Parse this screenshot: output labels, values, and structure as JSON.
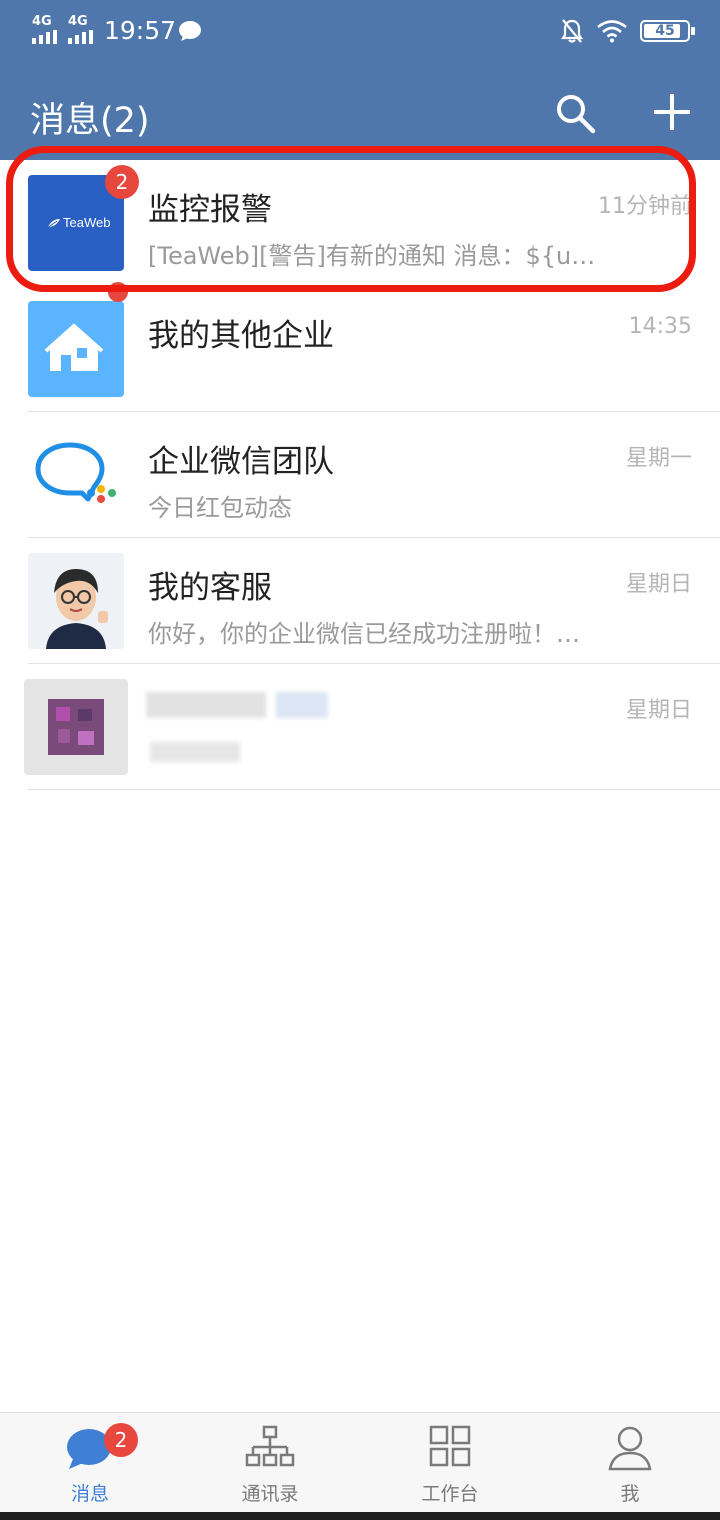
{
  "status_bar": {
    "network1": "4G",
    "network2": "4G",
    "time": "19:57",
    "battery": "45"
  },
  "header": {
    "title": "消息(2)"
  },
  "conversations": [
    {
      "name": "监控报警",
      "preview": "[TeaWeb][警告]有新的通知 消息：${u…",
      "time": "11分钟前",
      "badge": "2",
      "avatar_text": "TeaWeb",
      "avatar_bg": "#2a5fc4"
    },
    {
      "name": "我的其他企业",
      "preview": "",
      "time": "14:35",
      "avatar_bg": "#5ab4ff"
    },
    {
      "name": "企业微信团队",
      "preview": "今日红包动态",
      "time": "星期一"
    },
    {
      "name": "我的客服",
      "preview": "你好，你的企业微信已经成功注册啦！…",
      "time": "星期日"
    },
    {
      "name": "",
      "preview": "",
      "time": "星期日"
    }
  ],
  "tabbar": {
    "tabs": [
      {
        "label": "消息",
        "badge": "2",
        "active": true
      },
      {
        "label": "通讯录"
      },
      {
        "label": "工作台"
      },
      {
        "label": "我"
      }
    ]
  },
  "colors": {
    "header_bg": "#4f77ab",
    "badge_red": "#e7473c",
    "highlight_red": "#ec1c10",
    "active_tab": "#3f7fd4"
  }
}
